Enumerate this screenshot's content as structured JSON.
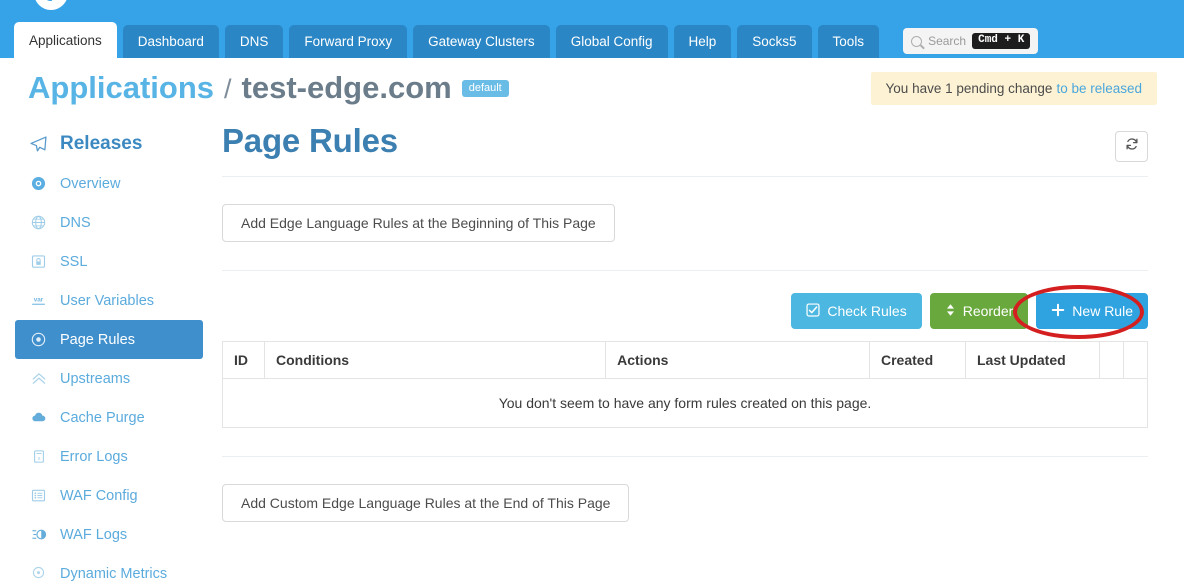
{
  "topbar": {
    "brand_logo": "circle-logo",
    "brand_text": "",
    "tabs": [
      {
        "label": "Applications",
        "active": true
      },
      {
        "label": "Dashboard",
        "active": false
      },
      {
        "label": "DNS",
        "active": false
      },
      {
        "label": "Forward Proxy",
        "active": false
      },
      {
        "label": "Gateway Clusters",
        "active": false
      },
      {
        "label": "Global Config",
        "active": false
      },
      {
        "label": "Help",
        "active": false
      },
      {
        "label": "Socks5",
        "active": false
      },
      {
        "label": "Tools",
        "active": false
      }
    ],
    "search": {
      "placeholder": "Search",
      "shortcut": "Cmd + K"
    }
  },
  "breadcrumb": {
    "root": "Applications",
    "separator": "/",
    "current": "test-edge.com",
    "badge": "default"
  },
  "notice": {
    "text": "You have 1 pending change",
    "link": "to be released"
  },
  "sidebar": {
    "heading": {
      "label": "Releases",
      "icon": "paper-plane-icon"
    },
    "items": [
      {
        "label": "Overview",
        "icon": "dial-icon",
        "active": false
      },
      {
        "label": "DNS",
        "icon": "globe-icon",
        "active": false
      },
      {
        "label": "SSL",
        "icon": "certificate-lock-icon",
        "active": false
      },
      {
        "label": "User Variables",
        "icon": "var-icon",
        "active": false
      },
      {
        "label": "Page Rules",
        "icon": "target-icon",
        "active": true
      },
      {
        "label": "Upstreams",
        "icon": "double-chevron-up-icon",
        "active": false
      },
      {
        "label": "Cache Purge",
        "icon": "cloud-icon",
        "active": false
      },
      {
        "label": "Error Logs",
        "icon": "document-x-icon",
        "active": false
      },
      {
        "label": "WAF Config",
        "icon": "list-icon",
        "active": false
      },
      {
        "label": "WAF Logs",
        "icon": "waf-log-icon",
        "active": false
      },
      {
        "label": "Dynamic Metrics",
        "icon": "location-pin-icon",
        "active": false
      }
    ]
  },
  "main": {
    "title": "Page Rules",
    "refresh_button": "refresh-icon",
    "top_ghost_button": "Add Edge Language Rules at the Beginning of This Page",
    "bottom_ghost_button": "Add Custom Edge Language Rules at the End of This Page",
    "actions": {
      "check_rules": "Check Rules",
      "reorder": "Reorder",
      "new_rule": "New Rule"
    },
    "table": {
      "columns": [
        "ID",
        "Conditions",
        "Actions",
        "Created",
        "Last Updated",
        "",
        ""
      ],
      "empty_message": "You don't seem to have any form rules created on this page.",
      "rows": []
    }
  },
  "annotation": {
    "shape": "ellipse",
    "target": "new-rule-button",
    "color": "#d41f20"
  },
  "colors": {
    "topbar_blue": "#36a3e8",
    "tab_blue": "#2a86c4",
    "sidebar_active": "#3f8fcc",
    "link_blue": "#5babdd",
    "title_blue": "#3c7fb1",
    "notice_bg": "#fdf3d4",
    "btn_check": "#4cb7e0",
    "btn_reorder": "#68a83c",
    "btn_new": "#2fa3e0",
    "annotation_red": "#d41f20"
  }
}
